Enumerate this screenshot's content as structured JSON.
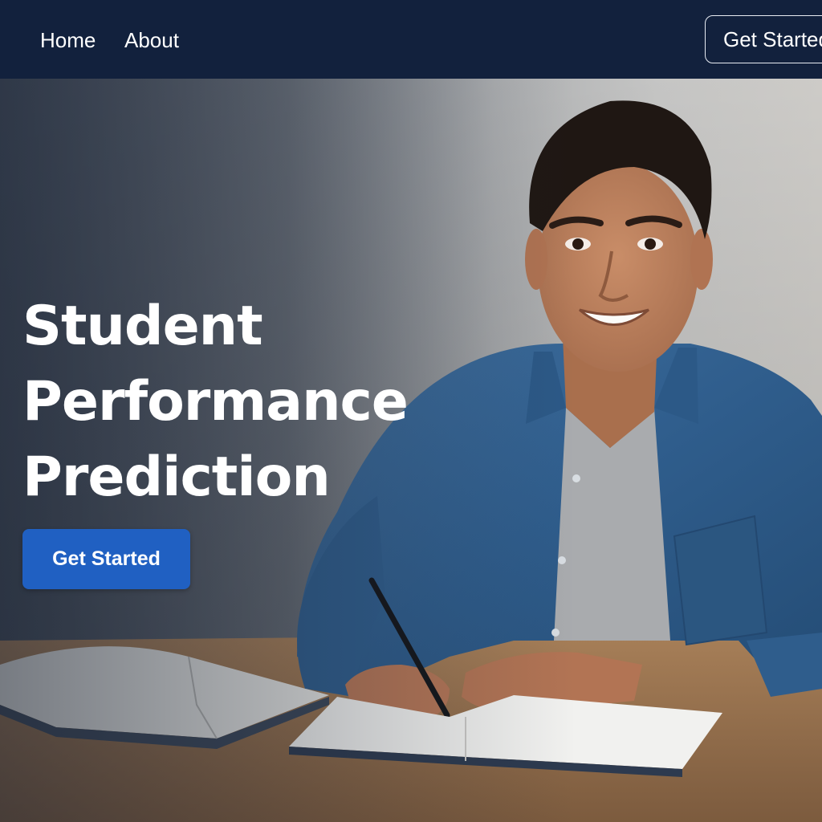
{
  "nav": {
    "home_label": "Home",
    "about_label": "About",
    "cta_label": "Get Started"
  },
  "hero": {
    "title_line_1": "Student",
    "title_line_2": "Performance",
    "title_line_3": "Prediction",
    "cta_label": "Get Started"
  },
  "colors": {
    "nav_background": "#12213d",
    "primary_button": "#2060c2",
    "text_light": "#ffffff"
  },
  "icons": {
    "hero_image": "student-writing-in-notebook-photo"
  }
}
